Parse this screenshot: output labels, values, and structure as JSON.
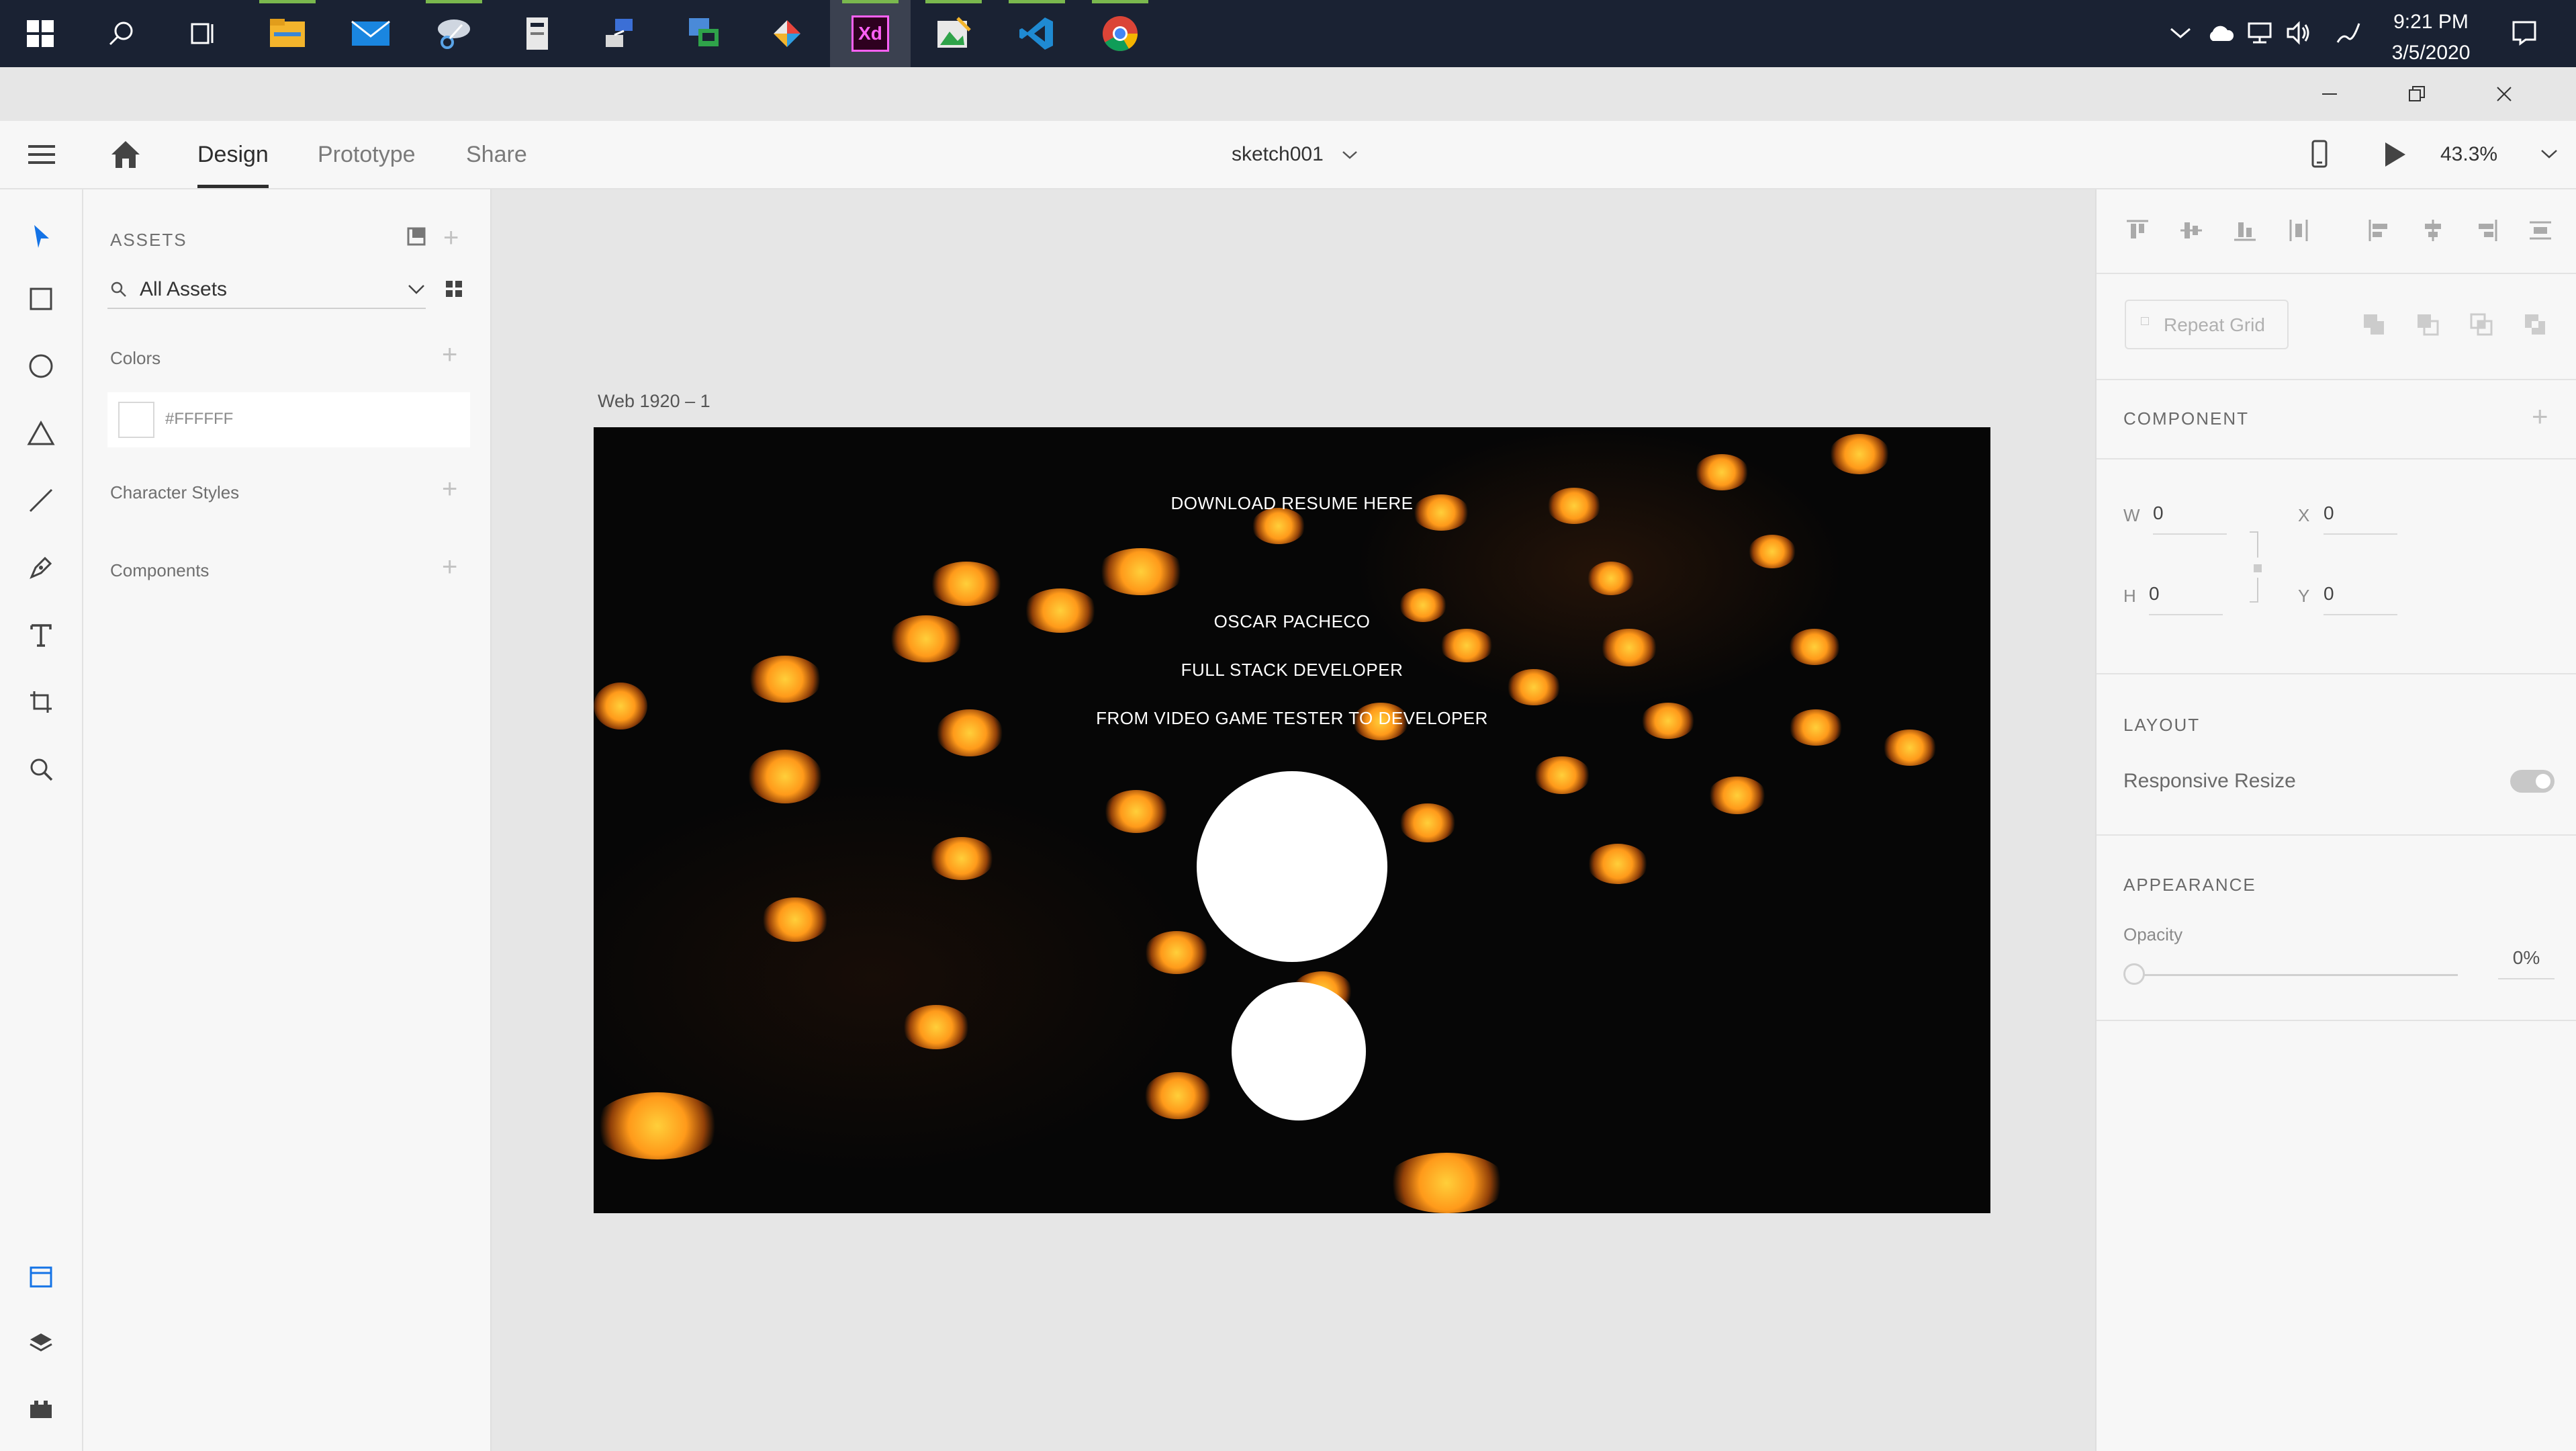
{
  "taskbar": {
    "apps": [
      {
        "name": "file-explorer-icon"
      },
      {
        "name": "mail-icon"
      },
      {
        "name": "snipping-tool-icon"
      },
      {
        "name": "document-app-icon"
      },
      {
        "name": "network-app-icon"
      },
      {
        "name": "remote-desktop-icon"
      },
      {
        "name": "git-app-icon"
      },
      {
        "name": "adobe-xd-icon",
        "label": "Xd"
      },
      {
        "name": "image-editor-icon"
      },
      {
        "name": "vscode-icon"
      },
      {
        "name": "chrome-icon"
      }
    ],
    "clock": {
      "time": "9:21 PM",
      "date": "3/5/2020"
    }
  },
  "header": {
    "tabs": [
      {
        "label": "Design",
        "active": true
      },
      {
        "label": "Prototype",
        "active": false
      },
      {
        "label": "Share",
        "active": false
      }
    ],
    "document_title": "sketch001",
    "zoom": "43.3%"
  },
  "assets": {
    "title": "ASSETS",
    "filter": "All Assets",
    "colors_label": "Colors",
    "color_swatch": {
      "hex_label": "#FFFFFF",
      "color": "#FFFFFF"
    },
    "character_styles_label": "Character Styles",
    "components_label": "Components"
  },
  "artboard": {
    "name": "Web 1920 – 1",
    "download_text": "DOWNLOAD RESUME HERE",
    "name_text": "OSCAR PACHECO",
    "role_text": "FULL STACK DEVELOPER",
    "tagline_text": "FROM VIDEO GAME TESTER TO DEVELOPER"
  },
  "properties": {
    "repeat_grid_label": "Repeat Grid",
    "component_title": "COMPONENT",
    "w_label": "W",
    "w_value": "0",
    "x_label": "X",
    "x_value": "0",
    "h_label": "H",
    "h_value": "0",
    "y_label": "Y",
    "y_value": "0",
    "layout_title": "LAYOUT",
    "responsive_resize_label": "Responsive Resize",
    "responsive_resize_on": true,
    "appearance_title": "APPEARANCE",
    "opacity_label": "Opacity",
    "opacity_value": "0%"
  },
  "colors": {
    "taskbar": "#1a2233",
    "accent": "#1473e6",
    "key_glow": "#ff9a1a"
  }
}
